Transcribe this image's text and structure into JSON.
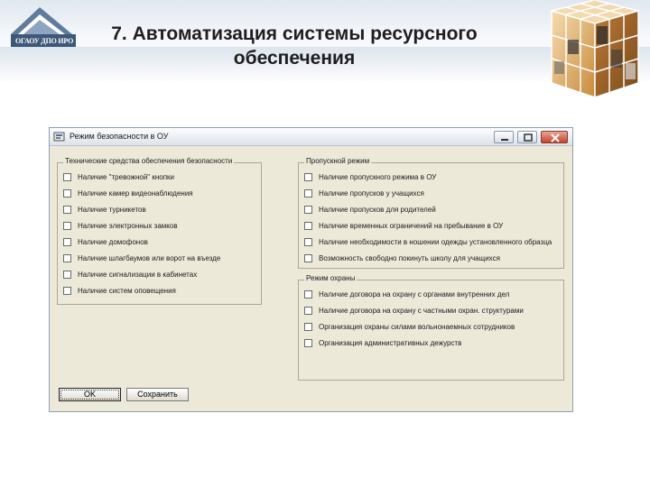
{
  "slide": {
    "title": "7. Автоматизация системы  ресурсного обеспечения",
    "logo_text": "ОГАОУ ДПО ИРО"
  },
  "dialog": {
    "title": "Режим безопасности в ОУ",
    "group_technical": {
      "legend": "Технические средства обеспечения безопасности",
      "items": [
        "Наличие \"тревожной\" кнопки",
        "Наличие камер видеонаблюдения",
        "Наличие турникетов",
        "Наличие электронных замков",
        "Наличие домофонов",
        "Наличие шлагбаумов или ворот на въезде",
        "Наличие сигнализации в кабинетах",
        "Наличие систем оповещения"
      ]
    },
    "group_access": {
      "legend": "Пропускной режим",
      "items": [
        "Наличие пропускного режима в ОУ",
        "Наличие пропусков у учащихся",
        "Наличие пропусков для родителей",
        "Наличие временных ограничений на пребывание в ОУ",
        "Наличие необходимости в ношении одежды установленного образца",
        "Возможность свободно покинуть школу для учащихся"
      ]
    },
    "group_guard": {
      "legend": "Режим охраны",
      "items": [
        "Наличие договора на охрану с органами внутренних дел",
        "Наличие договора на охрану с частными охран. структурами",
        "Организация охраны силами вольнонаемных сотрудников",
        "Организация административных дежурств"
      ]
    },
    "buttons": {
      "ok": "OK",
      "save": "Сохранить"
    },
    "checkbox_state": "unchecked"
  },
  "colors": {
    "window_face": "#ece9d8",
    "titlebar": "#dde3ec",
    "close_button": "#c6442d",
    "slide_band": "#dfe7ef"
  },
  "icons": [
    "app-icon",
    "minimize-icon",
    "maximize-icon",
    "close-icon",
    "logo-house-icon",
    "photo-cube-decoration"
  ]
}
